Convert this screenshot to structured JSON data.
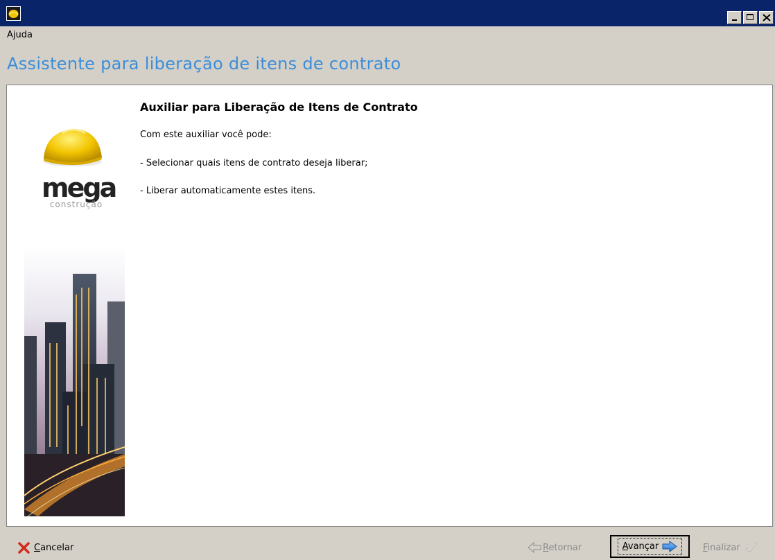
{
  "window": {
    "title": "",
    "controls": [
      "minimize",
      "maximize",
      "close"
    ]
  },
  "menu": {
    "items": [
      {
        "label": "Ajuda"
      }
    ]
  },
  "header": {
    "title": "Assistente para liberação de itens de contrato"
  },
  "content": {
    "heading": "Auxiliar para Liberação de Itens de Contrato",
    "paragraphs": [
      "Com este auxiliar você pode:",
      "- Selecionar quais itens de contrato deseja liberar;",
      "- Liberar automaticamente estes itens."
    ]
  },
  "brand": {
    "logo_word": "mega",
    "logo_sub": "construção",
    "helmet_color": "#f2c500"
  },
  "footer": {
    "cancel": {
      "accel": "C",
      "rest": "ancelar",
      "icon": "x-icon",
      "enabled": true
    },
    "back": {
      "accel": "R",
      "rest": "etornar",
      "icon": "arrow-left-icon",
      "enabled": false
    },
    "next": {
      "accel": "A",
      "rest": "vançar",
      "icon": "arrow-right-icon",
      "enabled": true,
      "focused": true
    },
    "finish": {
      "accel": "F",
      "rest": "inalizar",
      "icon": "check-icon",
      "enabled": false
    }
  },
  "colors": {
    "titlebar": "#0a246a",
    "header_text": "#3b8ed9",
    "face": "#d4d0c8",
    "disabled_text": "#8a8a8a"
  }
}
